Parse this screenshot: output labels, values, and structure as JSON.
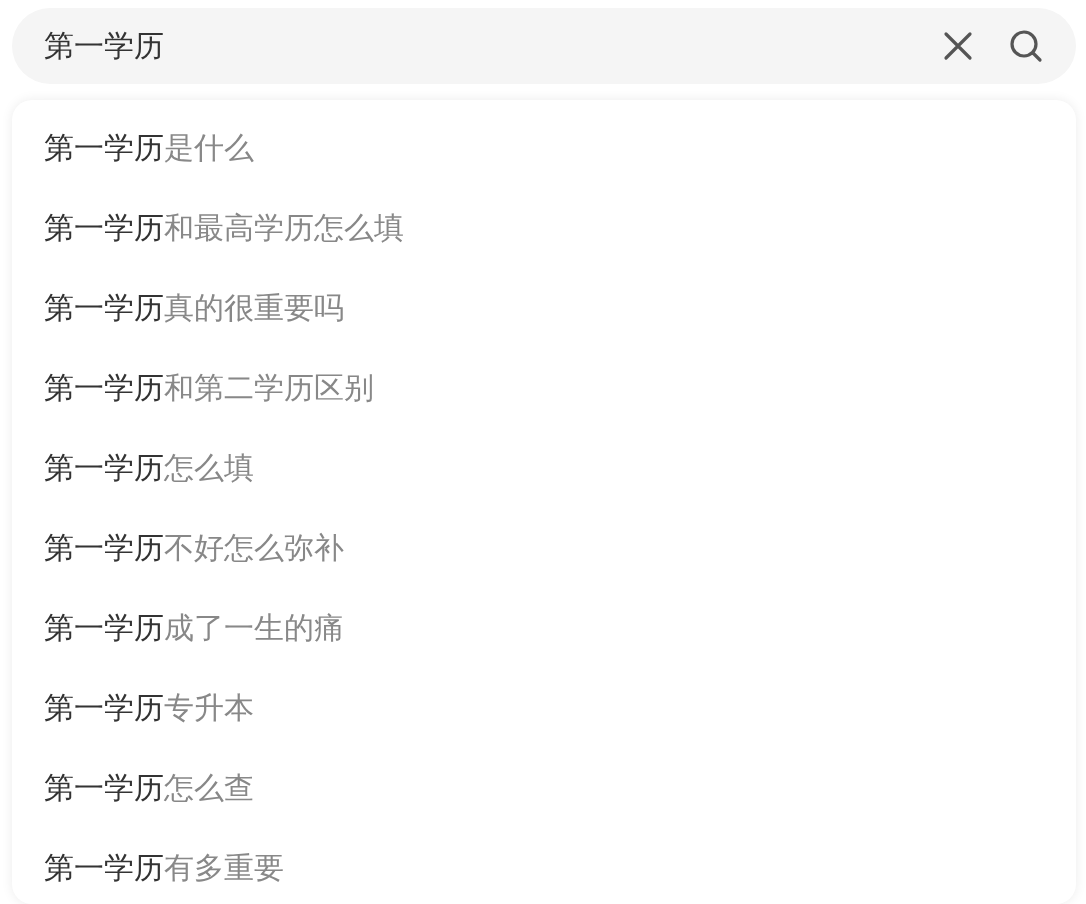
{
  "search": {
    "value": "第一学历"
  },
  "suggestions": [
    {
      "match": "第一学历",
      "rest": "是什么"
    },
    {
      "match": "第一学历",
      "rest": "和最高学历怎么填"
    },
    {
      "match": "第一学历",
      "rest": "真的很重要吗"
    },
    {
      "match": "第一学历",
      "rest": "和第二学历区别"
    },
    {
      "match": "第一学历",
      "rest": "怎么填"
    },
    {
      "match": "第一学历",
      "rest": "不好怎么弥补"
    },
    {
      "match": "第一学历",
      "rest": "成了一生的痛"
    },
    {
      "match": "第一学历",
      "rest": "专升本"
    },
    {
      "match": "第一学历",
      "rest": "怎么查"
    },
    {
      "match": "第一学历",
      "rest": "有多重要"
    }
  ]
}
